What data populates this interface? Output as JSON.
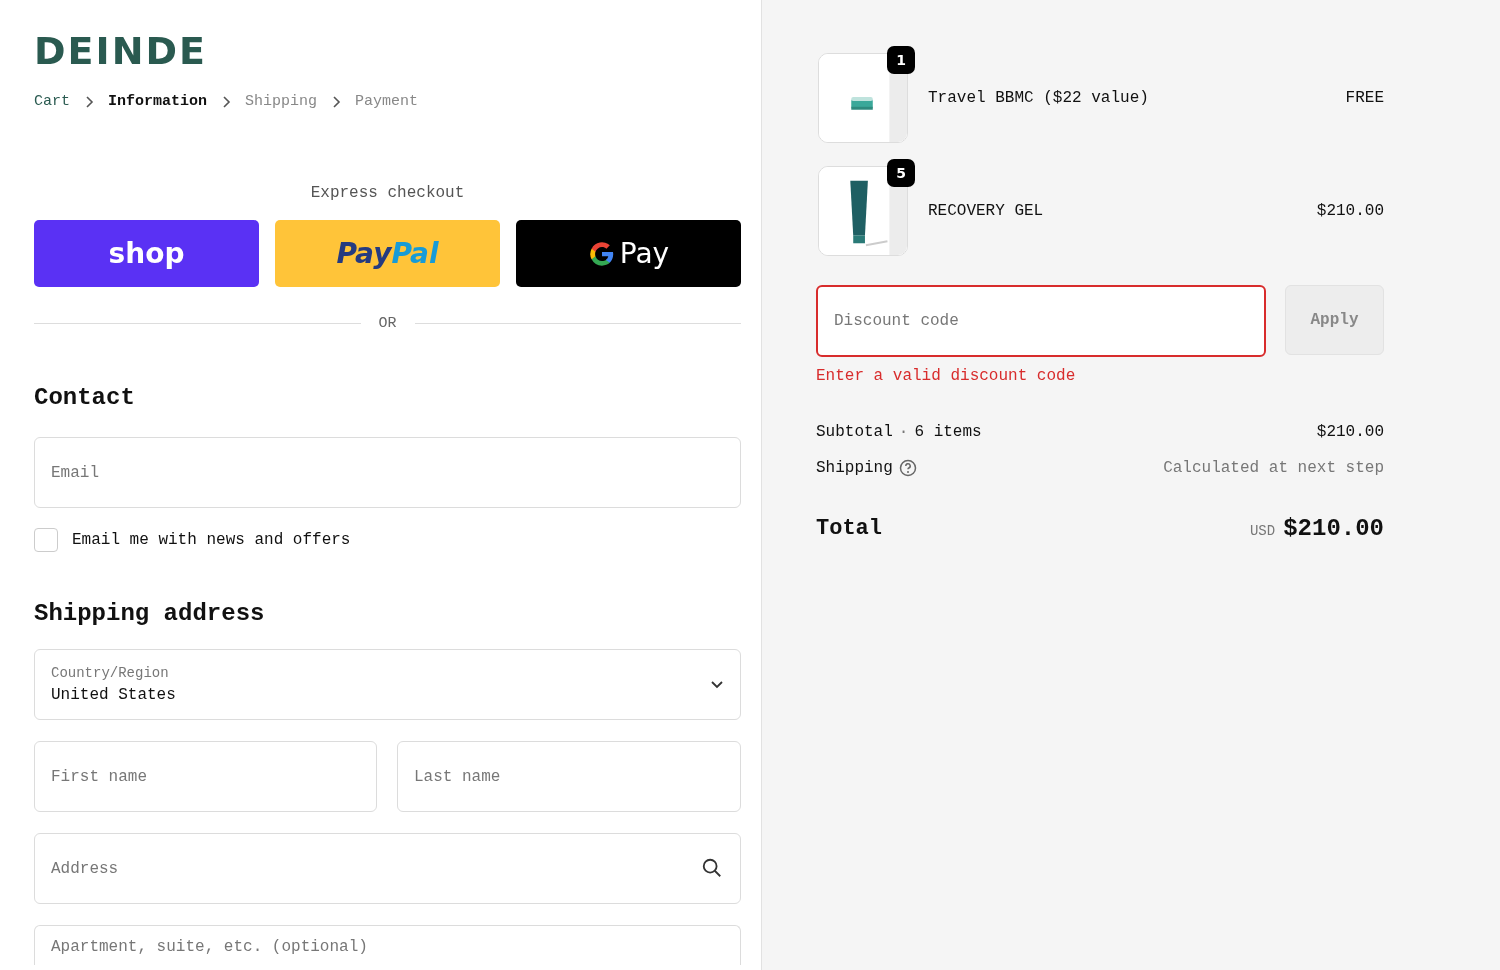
{
  "brand": {
    "logo": "DEINDE"
  },
  "breadcrumbs": [
    {
      "label": "Cart",
      "selected": false,
      "visited": true
    },
    {
      "label": "Information",
      "selected": true,
      "visited": false
    },
    {
      "label": "Shipping",
      "selected": false,
      "visited": false
    },
    {
      "label": "Payment",
      "selected": false,
      "visited": false
    }
  ],
  "express_checkout": {
    "title": "Express checkout",
    "buttons": [
      {
        "kind": "shop",
        "parts": [
          "shop"
        ]
      },
      {
        "kind": "paypal",
        "parts": [
          "Pay",
          "Pal"
        ]
      },
      {
        "kind": "gpay",
        "parts": [
          "Pay"
        ]
      }
    ],
    "divider": "OR"
  },
  "contact": {
    "heading": "Contact",
    "email": {
      "placeholder": "Email"
    },
    "newsletter": {
      "label": "Email me with news and offers",
      "checked": false
    }
  },
  "shipping_address": {
    "heading": "Shipping address",
    "country": {
      "label": "Country/Region",
      "value": "United States"
    },
    "first_name": {
      "placeholder": "First name"
    },
    "last_name": {
      "placeholder": "Last name"
    },
    "address": {
      "placeholder": "Address"
    },
    "apartment": {
      "placeholder": "Apartment, suite, etc. (optional)"
    }
  },
  "order_summary": {
    "items": [
      {
        "name": "Travel BBMC ($22 value)",
        "quantity": "1",
        "price": "FREE",
        "kind": "jar"
      },
      {
        "name": "RECOVERY GEL",
        "quantity": "5",
        "price": "$210.00",
        "kind": "tube"
      }
    ],
    "discount": {
      "placeholder": "Discount code",
      "error": "Enter a valid discount code",
      "button": "Apply",
      "invalid": true
    },
    "subtotal": {
      "label": "Subtotal",
      "separator": "·",
      "count": "6 items",
      "value": "$210.00"
    },
    "shipping": {
      "label": "Shipping",
      "value": "Calculated at next step"
    },
    "total": {
      "label": "Total",
      "currency": "USD",
      "value": "$210.00"
    }
  }
}
